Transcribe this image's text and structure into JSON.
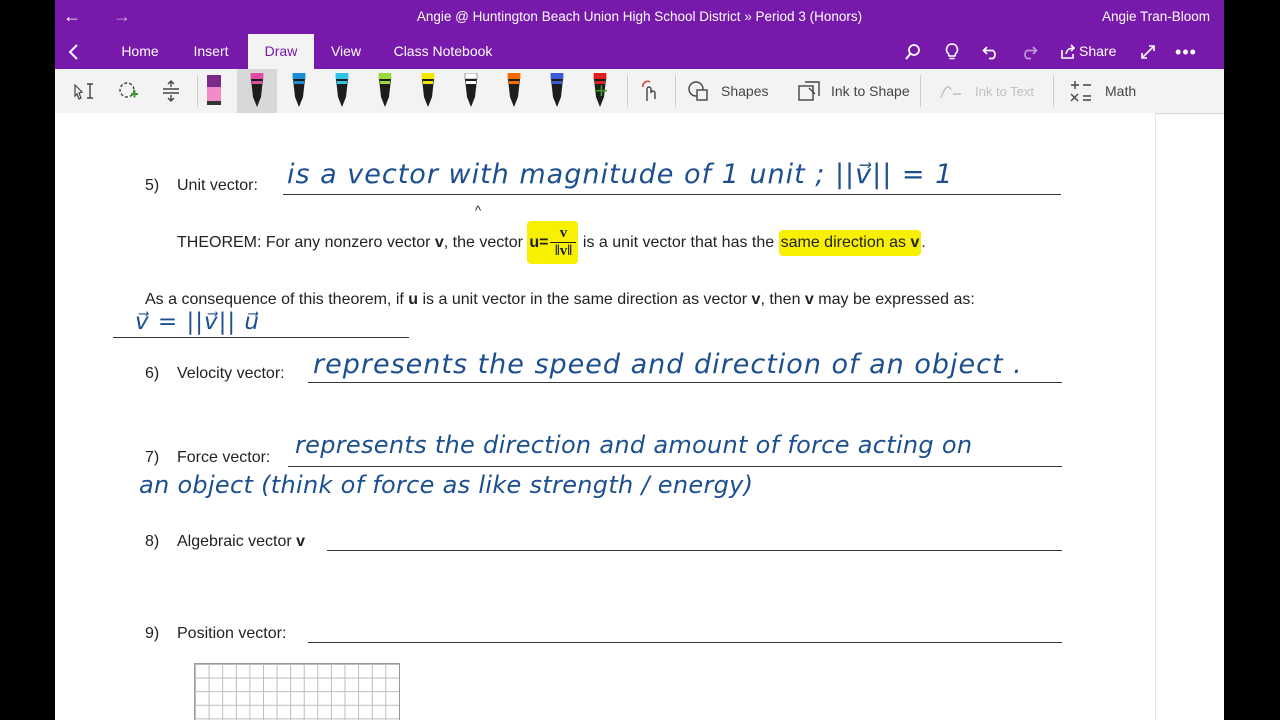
{
  "window": {
    "title": "Angie @ Huntington Beach Union High School District » Period 3 (Honors)",
    "user": "Angie Tran-Bloom"
  },
  "ribbon": {
    "tabs": [
      {
        "label": "Home"
      },
      {
        "label": "Insert"
      },
      {
        "label": "Draw"
      },
      {
        "label": "View"
      },
      {
        "label": "Class Notebook"
      }
    ],
    "share_label": "Share"
  },
  "toolbar": {
    "shapes_label": "Shapes",
    "ink_to_shape_label": "Ink to Shape",
    "ink_to_text_label": "Ink to Text",
    "math_label": "Math",
    "pens": [
      {
        "color": "#e04ca0"
      },
      {
        "color": "#1a8fd6"
      },
      {
        "color": "#2ec4e6"
      },
      {
        "color": "#9bd93b"
      },
      {
        "color": "#f2e600"
      },
      {
        "color": "#ffffff"
      },
      {
        "color": "#ff6a00"
      },
      {
        "color": "#3b5bdb"
      },
      {
        "color": "#e02020"
      }
    ]
  },
  "page": {
    "items": {
      "unit": {
        "number": "5)",
        "label": "Unit vector:",
        "ink": "is a vector with magnitude of 1 unit  ; ||v⃗|| = 1"
      },
      "velocity": {
        "number": "6)",
        "label": "Velocity vector:",
        "ink": "represents the speed and direction of an object ."
      },
      "force": {
        "number": "7)",
        "label": "Force vector:",
        "ink_line1": "represents the direction and amount of force acting on",
        "ink_line2": "an object (think of force as like strength / energy)"
      },
      "algebraic": {
        "number": "8)",
        "label_prefix": "Algebraic vector",
        "label_bold": "v"
      },
      "position": {
        "number": "9)",
        "label": "Position vector:"
      }
    },
    "theorem": {
      "prefix": "THEOREM: For any nonzero vector ",
      "v1": "v",
      "mid": ", the vector ",
      "u_eq": "u=",
      "frac_num": "v",
      "frac_den": "‖v‖",
      "after": " is a unit vector that has the ",
      "highlight": "same direction as ",
      "v2": "v",
      "end": ".",
      "hat": "^"
    },
    "consequence": {
      "t1": "As a consequence of this theorem, if ",
      "u": "u",
      "t2": " is a unit vector in the same direction as vector ",
      "v1": "v",
      "t3": ", then ",
      "v2": "v",
      "t4": " may be expressed as:",
      "ink": "v⃗ = ||v⃗|| u⃗"
    }
  }
}
